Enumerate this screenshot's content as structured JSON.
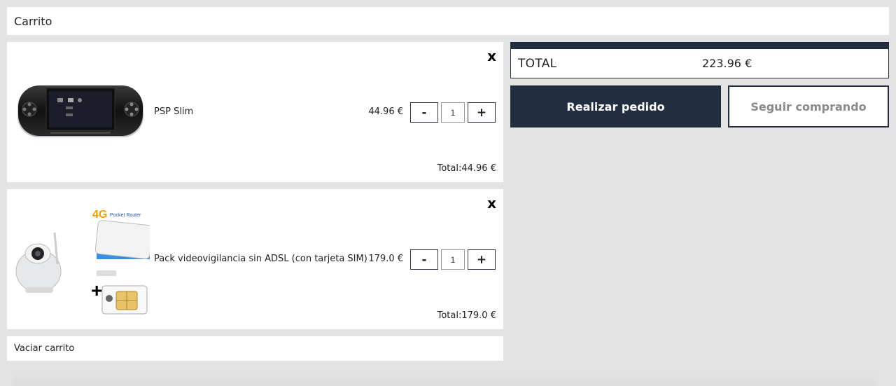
{
  "header": {
    "title": "Carrito"
  },
  "cart": {
    "items": [
      {
        "name": "PSP Slim",
        "price": "44.96 €",
        "quantity": "1",
        "minus_label": "-",
        "plus_label": "+",
        "remove_label": "x",
        "total": "Total:44.96 €"
      },
      {
        "name": "Pack videovigilancia sin ADSL (con tarjeta SIM)",
        "price": "179.0 €",
        "quantity": "1",
        "minus_label": "-",
        "plus_label": "+",
        "remove_label": "x",
        "total": "Total:179.0 €",
        "image_text": {
          "badge": "4G",
          "subtitle": "Pocket Router",
          "plus_sign": "+"
        }
      }
    ],
    "empty_label": "Vaciar carrito"
  },
  "summary": {
    "total_label": "TOTAL",
    "total_value": "223.96 €",
    "order_button": "Realizar pedido",
    "continue_button": "Seguir comprando"
  },
  "colors": {
    "accent": "#222e3f",
    "page_bg": "#e3e3e3"
  }
}
